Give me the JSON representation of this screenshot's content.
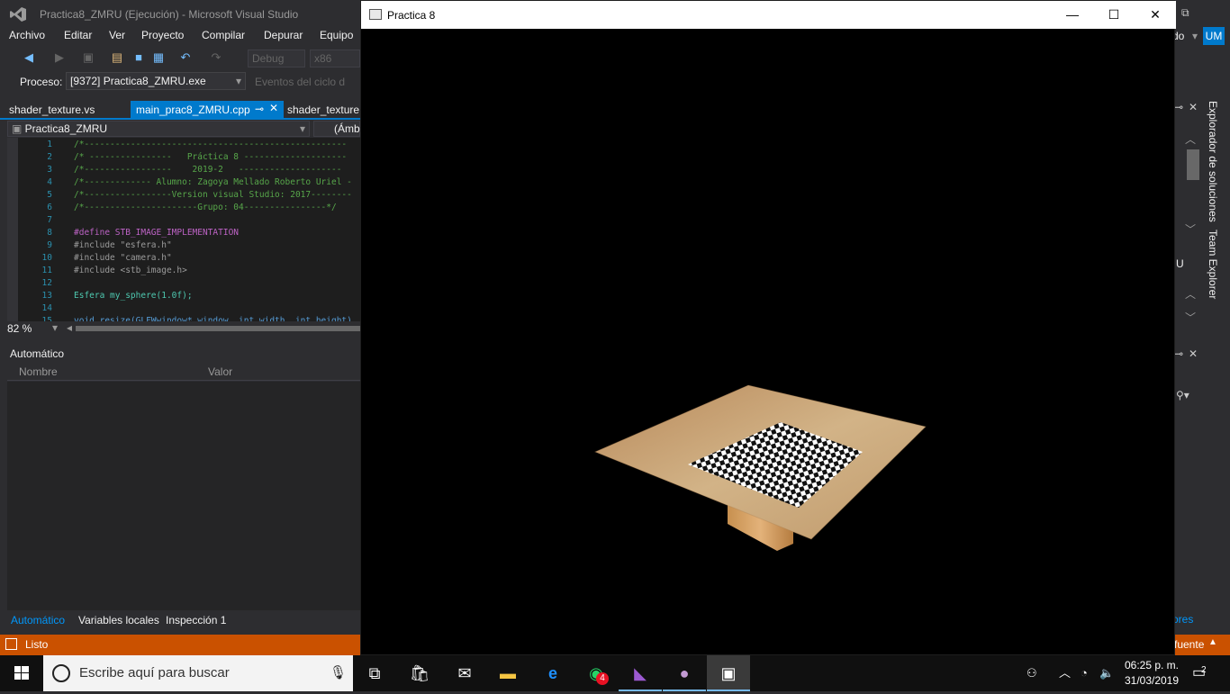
{
  "vs": {
    "title": "Practica8_ZMRU (Ejecución) - Microsoft Visual Studio",
    "menu": [
      "Archivo",
      "Editar",
      "Ver",
      "Proyecto",
      "Compilar",
      "Depurar",
      "Equipo"
    ],
    "config": "Debug",
    "platform": "x86",
    "process_label": "Proceso:",
    "process_value": "[9372] Practica8_ZMRU.exe",
    "events_label": "Eventos del ciclo d",
    "tabs": [
      "shader_texture.vs",
      "main_prac8_ZMRU.cpp",
      "shader_texture."
    ],
    "nav_project": "Practica8_ZMRU",
    "nav_scope": "(Ámbi",
    "code_lines": [
      {
        "n": "1",
        "t": "/*---------------------------------------------------"
      },
      {
        "n": "2",
        "t": "/* ----------------   Práctica 8 --------------------"
      },
      {
        "n": "3",
        "t": "/*-----------------    2019-2   --------------------"
      },
      {
        "n": "4",
        "t": "/*------------- Alumno: Zagoya Mellado Roberto Uriel -"
      },
      {
        "n": "5",
        "t": "/*-----------------Version visual Studio: 2017--------"
      },
      {
        "n": "6",
        "t": "/*----------------------Grupo: 04----------------*/"
      },
      {
        "n": "7",
        "t": ""
      },
      {
        "n": "8",
        "t": "#define STB_IMAGE_IMPLEMENTATION"
      },
      {
        "n": "9",
        "t": "#include \"esfera.h\""
      },
      {
        "n": "10",
        "t": "#include \"camera.h\""
      },
      {
        "n": "11",
        "t": "#include <stb_image.h>"
      },
      {
        "n": "12",
        "t": ""
      },
      {
        "n": "13",
        "t": "Esfera my_sphere(1.0f);"
      },
      {
        "n": "14",
        "t": ""
      },
      {
        "n": "15",
        "t": "void resize(GLFWwindow* window, int width, int height)"
      }
    ],
    "zoom": "82 %",
    "auto_panel_title": "Automático",
    "col_name": "Nombre",
    "col_value": "Valor",
    "bottom_tabs": [
      "Automático",
      "Variables locales",
      "Inspección 1"
    ],
    "status": "Listo",
    "right_status": "fuente",
    "solution_explorer": "Explorador de soluciones",
    "team_explorer": "Team Explorer",
    "right_fragment": "do",
    "user_initials": "UM",
    "right_label_u": "U",
    "right_label_ores": "ores"
  },
  "game": {
    "title": "Practica 8"
  },
  "taskbar": {
    "search_placeholder": "Escribe aquí para buscar",
    "whatsapp_badge": "4",
    "time": "06:25 p. m.",
    "date": "31/03/2019",
    "notifications": "2"
  }
}
